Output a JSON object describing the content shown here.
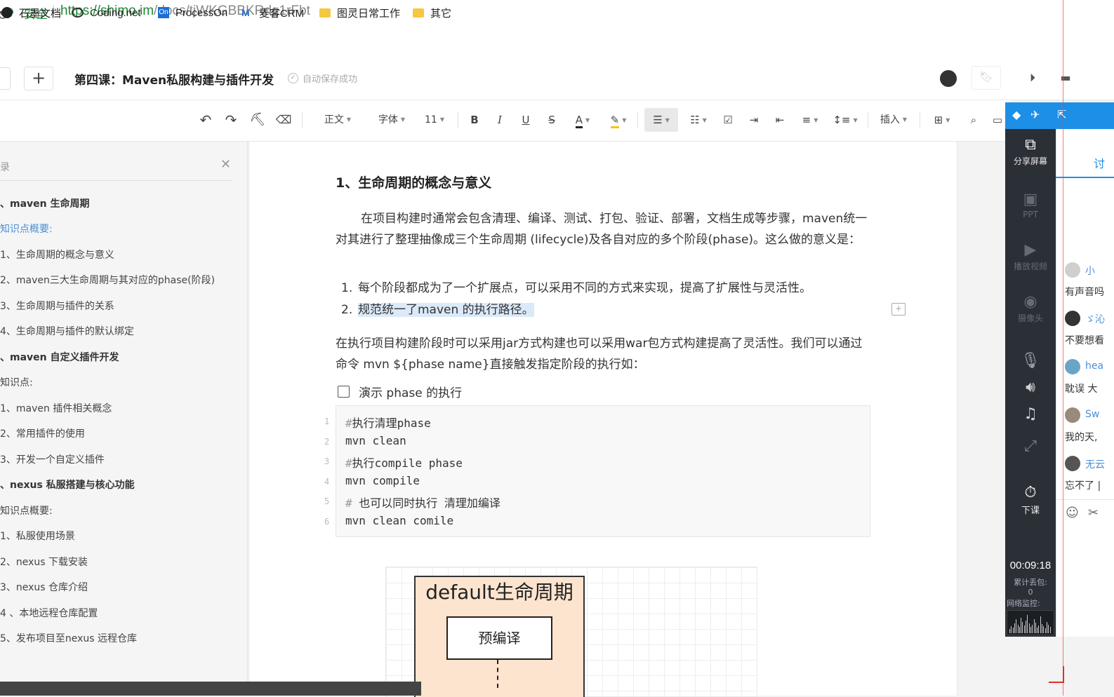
{
  "browser": {
    "secure_label": "安全",
    "url_host": "https://shimo.im",
    "url_path": "/docs/tjWKGBBKRdg1rFbt"
  },
  "bookmarks": [
    {
      "label": "石墨文档",
      "icon": "shimo-icon"
    },
    {
      "label": "Coding.net",
      "icon": "coding-icon"
    },
    {
      "label": "ProcessOn",
      "icon": "processon-icon"
    },
    {
      "label": "麦客CRM",
      "icon": "mikecrm-icon"
    },
    {
      "label": "图灵日常工作",
      "icon": "folder-icon"
    },
    {
      "label": "其它",
      "icon": "folder-icon"
    }
  ],
  "header": {
    "doc_title": "第四课：Maven私服构建与插件开发",
    "save_status": "自动保存成功"
  },
  "toolbar": {
    "style": "正文",
    "font": "字体",
    "size": "11",
    "insert": "插入"
  },
  "toc": {
    "title": "录",
    "items": [
      {
        "text": "、maven 生命周期",
        "kind": "bold"
      },
      {
        "text": "知识点概要:",
        "kind": "link"
      },
      {
        "text": "1、生命周期的概念与意义",
        "kind": "normal"
      },
      {
        "text": "2、maven三大生命周期与其对应的phase(阶段)",
        "kind": "normal"
      },
      {
        "text": "3、生命周期与插件的关系",
        "kind": "normal"
      },
      {
        "text": "4、生命周期与插件的默认绑定",
        "kind": "normal"
      },
      {
        "text": "、maven 自定义插件开发",
        "kind": "bold"
      },
      {
        "text": "知识点:",
        "kind": "normal"
      },
      {
        "text": "1、maven 插件相关概念",
        "kind": "normal"
      },
      {
        "text": "2、常用插件的使用",
        "kind": "normal"
      },
      {
        "text": "3、开发一个自定义插件",
        "kind": "normal"
      },
      {
        "text": "、nexus 私服搭建与核心功能",
        "kind": "bold"
      },
      {
        "text": "知识点概要:",
        "kind": "normal"
      },
      {
        "text": "1、私服使用场景",
        "kind": "normal"
      },
      {
        "text": "2、nexus 下载安装",
        "kind": "normal"
      },
      {
        "text": "3、nexus 仓库介绍",
        "kind": "normal"
      },
      {
        "text": "4 、本地远程仓库配置",
        "kind": "normal"
      },
      {
        "text": "5、发布项目至nexus 远程仓库",
        "kind": "normal"
      }
    ]
  },
  "doc": {
    "heading": "1、生命周期的概念与意义",
    "para1": "在项目构建时通常会包含清理、编译、测试、打包、验证、部署，文档生成等步骤，maven统一对其进行了整理抽像成三个生命周期 (lifecycle)及各自对应的多个阶段(phase)。这么做的意义是：",
    "list": [
      {
        "num": "1.",
        "text": "每个阶段都成为了一个扩展点，可以采用不同的方式来实现，提高了扩展性与灵活性。"
      },
      {
        "num": "2.",
        "text": "规范统一了maven 的执行路径。"
      }
    ],
    "para2": "在执行项目构建阶段时可以采用jar方式构建也可以采用war包方式构建提高了灵活性。我们可以通过命令 mvn ${phase name}直接触发指定阶段的执行如：",
    "task": "演示 phase 的执行",
    "code_lines": [
      {
        "n": "1",
        "hash": "#",
        "text": "执行清理phase"
      },
      {
        "n": "2",
        "hash": "",
        "text": "mvn clean"
      },
      {
        "n": "3",
        "hash": "#",
        "text": "执行compile phase"
      },
      {
        "n": "4",
        "hash": "",
        "text": "mvn compile"
      },
      {
        "n": "5",
        "hash": "#",
        "text": " 也可以同时执行 清理加编译"
      },
      {
        "n": "6",
        "hash": "",
        "text": "mvn clean comile"
      }
    ],
    "diagram_title": "default生命周期",
    "diagram_step": "预编译"
  },
  "side_panel": {
    "share": "分享屏幕",
    "ppt": "PPT",
    "video": "播放视频",
    "camera": "摄像头",
    "end": "下课",
    "timer": "00:09:18",
    "packet_loss_label": "累计丢包:",
    "packet_loss_value": "0",
    "net_label": "网络监控:"
  },
  "chat": {
    "tab": "讨",
    "messages": [
      {
        "name": "小",
        "text": "有声音吗"
      },
      {
        "name": "ゞ沁",
        "text": "不要想看"
      },
      {
        "name": "hea",
        "text": "耽误 大"
      },
      {
        "name": "Sw",
        "text": "我的天,"
      },
      {
        "name": "无云",
        "text": "忘不了 |"
      }
    ]
  }
}
